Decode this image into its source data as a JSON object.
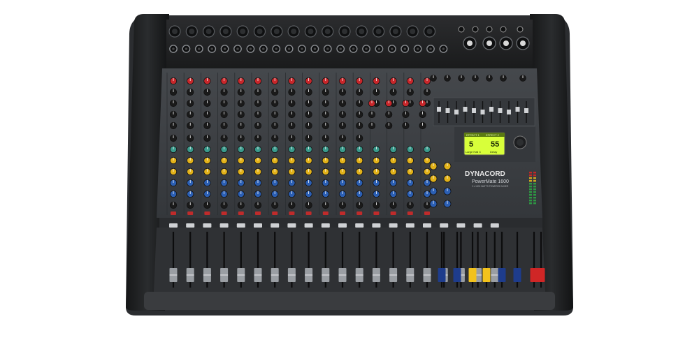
{
  "brand": {
    "name": "DYNACORD",
    "model": "PowerMate 1600",
    "subtitle": "2 x 1000 WATTS POWERED MIXER"
  },
  "display": {
    "left_title": "EFFECT 1",
    "left_value": "5",
    "left_name": "Large Hall 3",
    "right_title": "EFFECT 2",
    "right_value": "55",
    "right_name": "Delay"
  },
  "colors": {
    "body": "#2e3033",
    "panel": "#3c3f43",
    "rear": "#1c1d1f",
    "knob_dark": "#1a1a1a",
    "knob_red": "#c8272b",
    "knob_yellow": "#e2b21a",
    "knob_blue": "#2b5fb4",
    "knob_green": "#3a9a8c",
    "lcd_bg": "#d8ff3a",
    "fader_cap": "#9a9ea3",
    "fader_blue": "#1e3c8c",
    "fader_yellow": "#f2c21c",
    "fader_red": "#d02626"
  },
  "channels": {
    "mono_count": 16,
    "stereo_count": 4,
    "master_faders": [
      "aux1",
      "aux2",
      "fx1",
      "fx2",
      "monitor1",
      "monitor2",
      "master-l",
      "master-r"
    ]
  }
}
